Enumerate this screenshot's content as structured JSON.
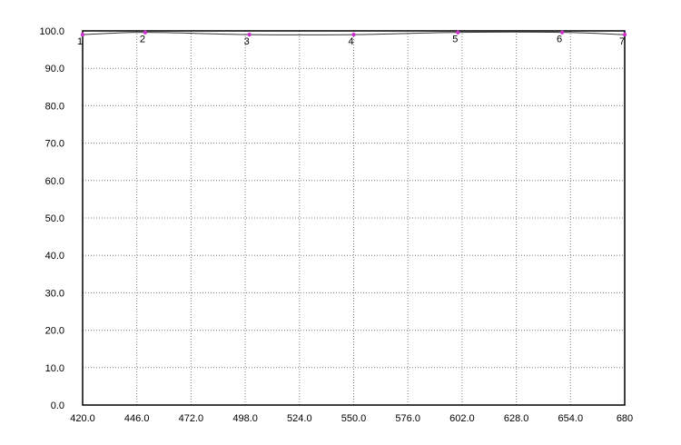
{
  "chart_data": {
    "type": "line",
    "title": "",
    "xlabel": "",
    "ylabel": "",
    "xlim": [
      420,
      680
    ],
    "ylim": [
      0,
      100
    ],
    "x_ticks": [
      "420.0",
      "446.0",
      "472.0",
      "498.0",
      "524.0",
      "550.0",
      "576.0",
      "602.0",
      "628.0",
      "654.0",
      "680"
    ],
    "y_ticks": [
      "0.0",
      "10.0",
      "20.0",
      "30.0",
      "40.0",
      "50.0",
      "60.0",
      "70.0",
      "80.0",
      "90.0",
      "100.0"
    ],
    "grid": true,
    "series": [
      {
        "x": [
          420,
          450,
          500,
          550,
          600,
          650,
          680
        ],
        "y": [
          99.0,
          99.6,
          99.0,
          99.0,
          99.6,
          99.6,
          99.0
        ],
        "point_labels": [
          "1",
          "2",
          "3",
          "4",
          "5",
          "6",
          "7"
        ],
        "color": "#333333",
        "marker_color": "#cc33cc"
      }
    ]
  }
}
